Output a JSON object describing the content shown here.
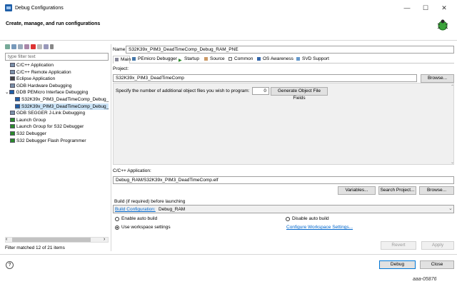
{
  "window": {
    "title": "Debug Configurations",
    "minimize": "—",
    "maximize": "☐",
    "close": "✕"
  },
  "header": {
    "title": "Create, manage, and run configurations"
  },
  "left": {
    "filter_placeholder": "type filter text",
    "tree": [
      {
        "label": "C/C++ Application",
        "indent": 1
      },
      {
        "label": "C/C++ Remote Application",
        "indent": 1
      },
      {
        "label": "Eclipse Application",
        "indent": 1
      },
      {
        "label": "GDB Hardware Debugging",
        "indent": 1
      },
      {
        "label": "GDB PEMicro Interface Debugging",
        "indent": 0,
        "expanded": true
      },
      {
        "label": "S32K39x_PIM3_DeadTimeComp_Debug_",
        "indent": 2
      },
      {
        "label": "S32K39x_PIM3_DeadTimeComp_Debug_",
        "indent": 2,
        "selected": true
      },
      {
        "label": "GDB SEGGER J-Link Debugging",
        "indent": 1
      },
      {
        "label": "Launch Group",
        "indent": 1
      },
      {
        "label": "Launch Group for S32 Debugger",
        "indent": 1
      },
      {
        "label": "S32 Debugger",
        "indent": 1
      },
      {
        "label": "S32 Debugger Flash Programmer",
        "indent": 1
      }
    ],
    "filter_message": "Filter matched 12 of 21 items"
  },
  "right": {
    "name_label": "Name:",
    "name_value": "S32K39x_PIM3_DeadTimeComp_Debug_RAM_PNE",
    "tabs": [
      "Main",
      "PEmicro Debugger",
      "Startup",
      "Source",
      "Common",
      "OS Awareness",
      "SVD Support"
    ],
    "project_label": "Project:",
    "project_value": "S32K39x_PIM3_DeadTimeComp",
    "browse_label": "Browse...",
    "objfiles_label": "Specify the number of additional object files you wish to program:",
    "objfiles_value": "0",
    "generate_label": "Generate Object File Fields",
    "app_label": "C/C++ Application:",
    "app_value": "Debug_RAM/S32K39x_PIM3_DeadTimeComp.elf",
    "variables_label": "Variables...",
    "search_label": "Search Project...",
    "browse2_label": "Browse...",
    "build_label": "Build (if required) before launching",
    "build_config_link": "Build Configuration:",
    "build_config_value": "Debug_RAM",
    "enable_auto": "Enable auto build",
    "disable_auto": "Disable auto build",
    "use_workspace": "Use workspace settings",
    "configure_ws": "Configure Workspace Settings...",
    "revert_label": "Revert",
    "apply_label": "Apply"
  },
  "footer": {
    "help": "?",
    "debug_label": "Debug",
    "close_label": "Close",
    "figure_id": "aaa-05876"
  }
}
